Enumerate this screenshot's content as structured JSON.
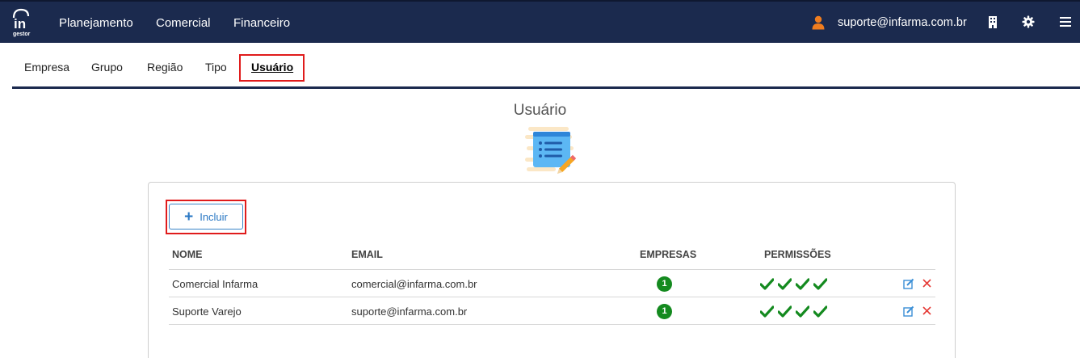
{
  "navbar": {
    "logo_text": "in",
    "logo_subtext": "gestor",
    "links": [
      "Planejamento",
      "Comercial",
      "Financeiro"
    ],
    "user_email": "suporte@infarma.com.br"
  },
  "tabs": [
    "Empresa",
    "Grupo",
    "Região",
    "Tipo",
    "Usuário"
  ],
  "active_tab": "Usuário",
  "page": {
    "title": "Usuário"
  },
  "toolbar": {
    "add_label": "Incluir",
    "add_icon": "+"
  },
  "table": {
    "columns": [
      "NOME",
      "EMAIL",
      "EMPRESAS",
      "PERMISSÕES"
    ],
    "rows": [
      {
        "name": "Comercial Infarma",
        "email": "comercial@infarma.com.br",
        "empresas": "1",
        "permissoes": 4
      },
      {
        "name": "Suporte Varejo",
        "email": "suporte@infarma.com.br",
        "empresas": "1",
        "permissoes": 4
      }
    ]
  },
  "colors": {
    "navbar": "#1b2a4e",
    "highlight": "#e01b1b",
    "accent": "#2a78c4",
    "success": "#148a1f",
    "user_icon": "#f07d1f",
    "delete": "#e53935"
  },
  "icons": {
    "user": "user-icon",
    "building": "building-icon",
    "settings": "gear-icon",
    "menu": "menu-icon",
    "edit": "edit-icon",
    "delete": "close-icon",
    "check": "check-icon"
  }
}
